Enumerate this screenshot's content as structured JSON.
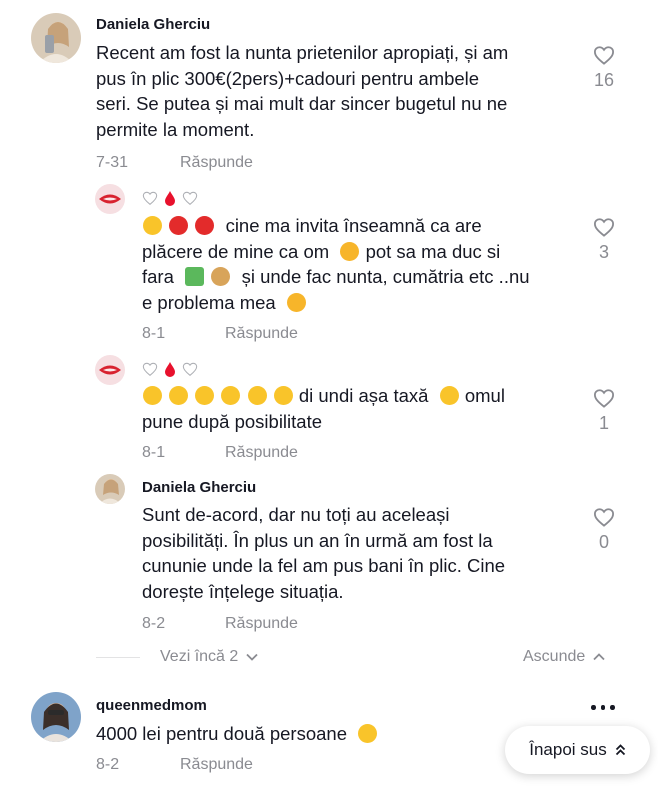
{
  "comments": [
    {
      "username": "Daniela Gherciu",
      "text": "Recent am fost la nunta prietenilor apropiați, și am pus în plic 300€(2pers)+cadouri pentru ambele seri. Se putea și mai mult dar sincer bugetul nu ne permite la moment.",
      "lines": [
        "Recent am fost la nunta prietenilor apropiați, și am",
        "pus în plic 300€(2pers)+cadouri pentru ambele",
        "seri. Se putea și mai mult dar sincer bugetul nu ne",
        "permite la moment."
      ],
      "date": "7-31",
      "reply_label": "Răspunde",
      "likes": "16"
    },
    {
      "username": "",
      "name_emoji": [
        "white-heart",
        "blood-drop",
        "white-heart"
      ],
      "lines": [
        "cine ma invita înseamnă ca are",
        "plăcere de mine ca om",
        "pot sa ma duc si",
        "fara",
        "și unde fac nunta, cumătria etc ..nu",
        "e problema mea"
      ],
      "emojis": [
        "monocle-face",
        "pouting-face",
        "pouting-face",
        "hugging-face",
        "money-wings",
        "money-bag",
        "hugging-face"
      ],
      "date": "8-1",
      "reply_label": "Răspunde",
      "likes": "3"
    },
    {
      "username": "",
      "name_emoji": [
        "white-heart",
        "blood-drop",
        "white-heart"
      ],
      "lines": [
        "di undi așa taxă",
        "omul",
        "pune după posibilitate"
      ],
      "emojis": [
        "flushed-face",
        "laughing-face",
        "rofl-face",
        "rofl-face",
        "laughing-face",
        "laughing-face",
        "flushed-face"
      ],
      "date": "8-1",
      "reply_label": "Răspunde",
      "likes": "1"
    },
    {
      "username": "Daniela Gherciu",
      "lines": [
        "Sunt de-acord, dar nu toți au aceleași",
        "posibilități. În plus un an în urmă am fost la",
        "cununie unde la fel am pus bani în plic. Cine",
        "dorește înțelege situația."
      ],
      "date": "8-2",
      "reply_label": "Răspunde",
      "likes": "0"
    },
    {
      "username": "queenmedmom",
      "lines": [
        "4000 lei pentru două persoane"
      ],
      "emojis": [
        "rolling-eyes-face"
      ],
      "date": "8-2",
      "reply_label": "Răspunde"
    }
  ],
  "view_more_label": "Vezi încă 2",
  "collapse_label": "Ascunde",
  "back_to_top_label": "Înapoi sus",
  "colors": {
    "muted": "#8a8b91",
    "text": "#161823",
    "red": "#e8112d"
  }
}
